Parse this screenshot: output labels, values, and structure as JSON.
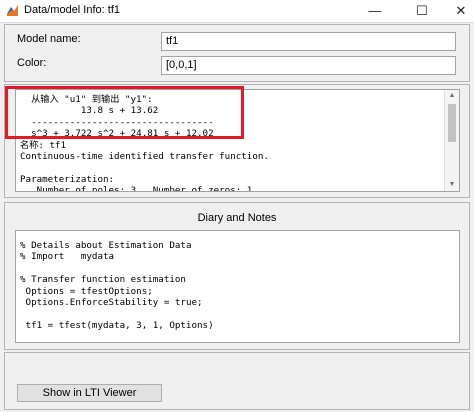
{
  "window": {
    "title": "Data/model Info: tf1",
    "minimize_glyph": "—",
    "maximize_glyph": "☐",
    "close_glyph": "✕"
  },
  "properties": {
    "model_name_label": "Model name:",
    "model_name_value": "tf1",
    "color_label": "Color:",
    "color_value": "[0,0,1]"
  },
  "info_text": {
    "lines": [
      "  从输入 \"u1\" 到输出 \"y1\":",
      "           13.8 s + 13.62",
      "  ---------------------------------",
      "  s^3 + 3.722 s^2 + 24.81 s + 12.02",
      "名称: tf1",
      "Continuous-time identified transfer function.",
      "",
      "Parameterization:",
      "   Number of poles: 3   Number of zeros: 1"
    ]
  },
  "diary": {
    "title": "Diary and Notes",
    "lines": [
      "% Details about Estimation Data",
      "% Import   mydata",
      "",
      "% Transfer function estimation",
      " Options = tfestOptions;",
      " Options.EnforceStability = true;",
      "",
      " tf1 = tfest(mydata, 3, 1, Options)"
    ]
  },
  "footer": {
    "lti_button_label": "Show in LTI Viewer"
  },
  "colors": {
    "highlight": "#e21b2a",
    "app_icon_orange": "#e6782a",
    "app_icon_blue": "#2a6fbf"
  }
}
